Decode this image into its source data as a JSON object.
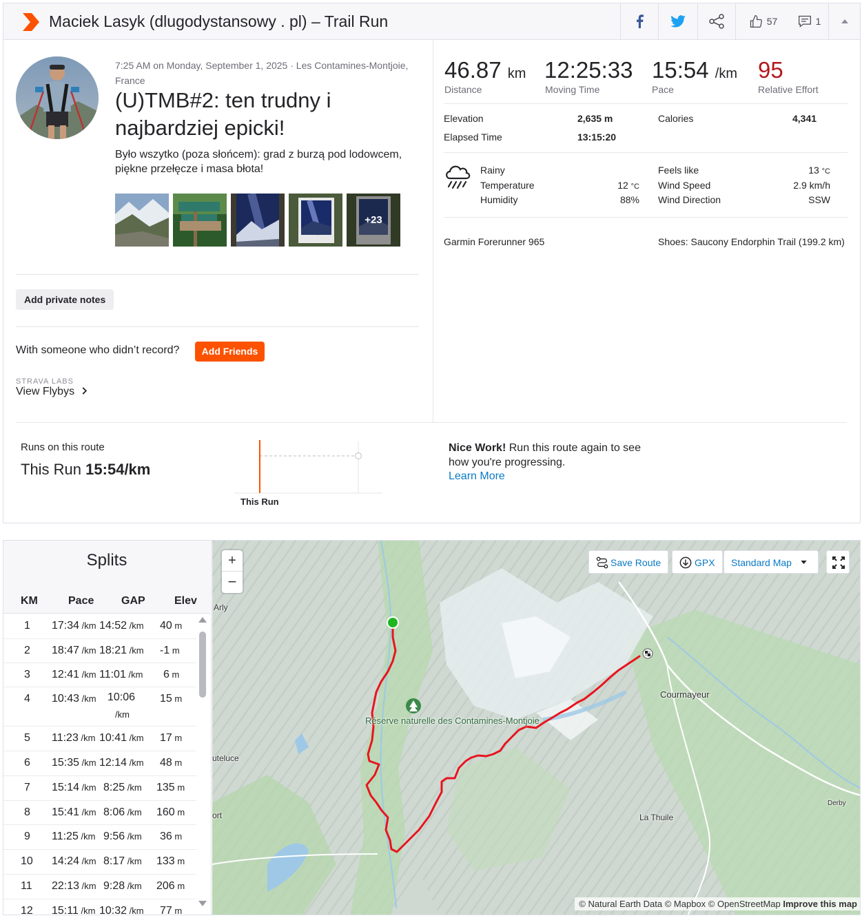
{
  "header": {
    "title": "Maciek Lasyk (dlugodystansowy . pl) – Trail Run",
    "kudos_count": "57",
    "comment_count": "1"
  },
  "activity": {
    "meta": "7:25 AM on Monday, September 1, 2025 · Les Contamines-Montjoie, France",
    "title": "(U)TMB#2: ten trudny i najbardziej epicki!",
    "description": "Było wszytko (poza słońcem): grad z burzą pod lodowcem, piękne przełęcze i masa błota!",
    "more_photos": "+23",
    "add_private_notes": "Add private notes",
    "with_someone": "With someone who didn’t record?",
    "add_friends": "Add Friends",
    "labs_label": "STRAVA LABS",
    "view_flybys": "View Flybys"
  },
  "stats": {
    "distance": {
      "value": "46.87",
      "unit": "km",
      "label": "Distance"
    },
    "moving_time": {
      "value": "12:25:33",
      "label": "Moving Time"
    },
    "pace": {
      "value": "15:54",
      "unit": "/km",
      "label": "Pace"
    },
    "relative_effort": {
      "value": "95",
      "label": "Relative Effort"
    },
    "elevation": {
      "label": "Elevation",
      "value": "2,635 m"
    },
    "elapsed_time": {
      "label": "Elapsed Time",
      "value": "13:15:20"
    },
    "calories": {
      "label": "Calories",
      "value": "4,341"
    }
  },
  "weather": {
    "condition": "Rainy",
    "temperature_label": "Temperature",
    "temperature_value": "12",
    "humidity_label": "Humidity",
    "humidity_value": "88%",
    "feels_like_label": "Feels like",
    "feels_like_value": "13",
    "wind_speed_label": "Wind Speed",
    "wind_speed_value": "2.9 km/h",
    "wind_direction_label": "Wind Direction",
    "wind_direction_value": "SSW",
    "temp_unit": "°C"
  },
  "gear": {
    "device": "Garmin Forerunner 965",
    "shoes": "Shoes: Saucony Endorphin Trail (199.2 km)"
  },
  "route_compare": {
    "label": "Runs on this route",
    "this_run_prefix": "This Run",
    "this_run_pace": "15:54/km",
    "chart_label": "This Run",
    "nice_work_bold": "Nice Work!",
    "nice_work_text": "Run this route again to see how you're progressing.",
    "learn_more": "Learn More"
  },
  "splits": {
    "title": "Splits",
    "headers": [
      "KM",
      "Pace",
      "GAP",
      "Elev"
    ],
    "pace_unit": "/km",
    "elev_unit": "m",
    "rows": [
      {
        "km": "1",
        "pace": "17:34",
        "gap": "14:52",
        "elev": "40"
      },
      {
        "km": "2",
        "pace": "18:47",
        "gap": "18:21",
        "elev": "-1"
      },
      {
        "km": "3",
        "pace": "12:41",
        "gap": "11:01",
        "elev": "6"
      },
      {
        "km": "4",
        "pace": "10:43",
        "gap": "10:06",
        "elev": "15"
      },
      {
        "km": "5",
        "pace": "11:23",
        "gap": "10:41",
        "elev": "17"
      },
      {
        "km": "6",
        "pace": "15:35",
        "gap": "12:14",
        "elev": "48"
      },
      {
        "km": "7",
        "pace": "15:14",
        "gap": "8:25",
        "elev": "135"
      },
      {
        "km": "8",
        "pace": "15:41",
        "gap": "8:06",
        "elev": "160"
      },
      {
        "km": "9",
        "pace": "11:25",
        "gap": "9:56",
        "elev": "36"
      },
      {
        "km": "10",
        "pace": "14:24",
        "gap": "8:17",
        "elev": "133"
      },
      {
        "km": "11",
        "pace": "22:13",
        "gap": "9:28",
        "elev": "206"
      },
      {
        "km": "12",
        "pace": "15:11",
        "gap": "10:32",
        "elev": "77"
      }
    ]
  },
  "map": {
    "save_route": "Save Route",
    "gpx": "GPX",
    "map_style": "Standard Map",
    "labels": {
      "arly": "Arly",
      "reserve": "Réserve naturelle des Contamines-Montjoie",
      "courmayeur": "Courmayeur",
      "la_thuile": "La Thuile",
      "derby": "Derby",
      "uteluce": "uteluce",
      "ort": "ort"
    },
    "attribution": "© Natural Earth Data © Mapbox © OpenStreetMap",
    "improve": "Improve this map",
    "route_color": "#e8141e"
  }
}
